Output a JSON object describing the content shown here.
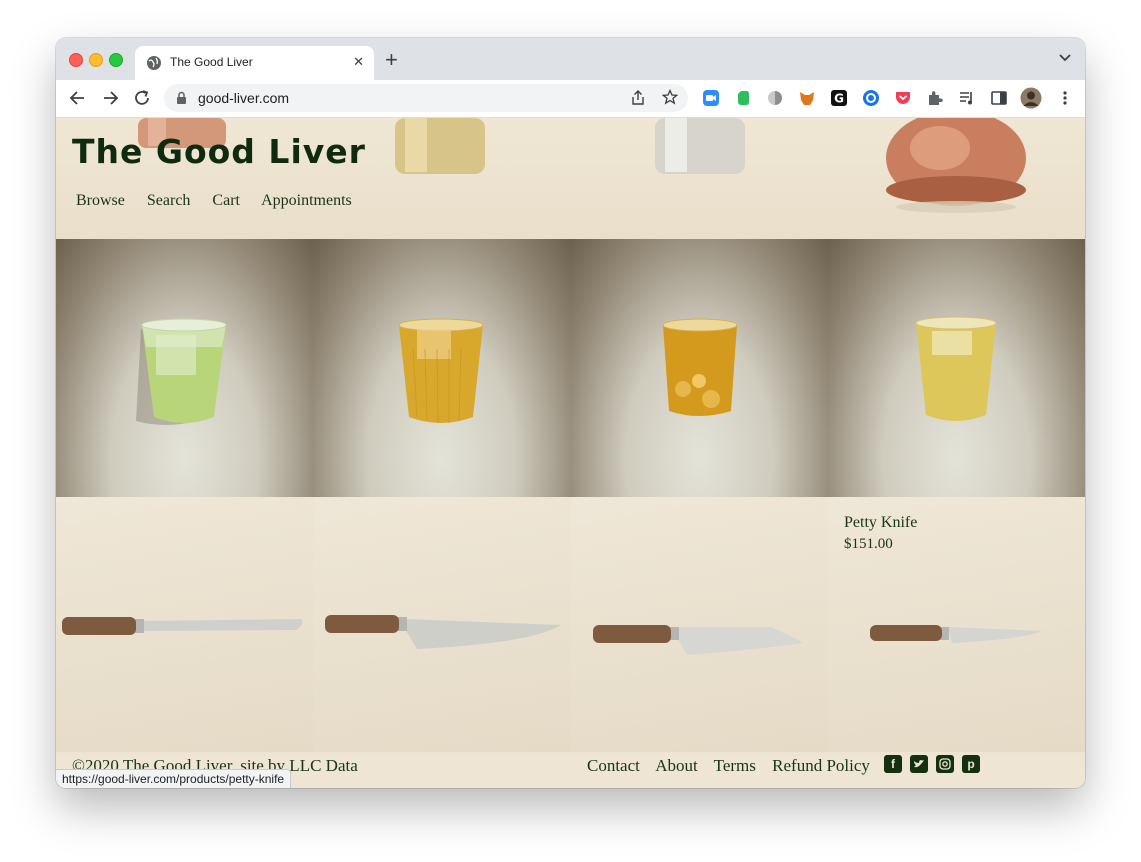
{
  "browser": {
    "tab_title": "The Good Liver",
    "url": "good-liver.com",
    "status_url": "https://good-liver.com/products/petty-knife"
  },
  "site": {
    "title": "The Good Liver",
    "nav": [
      "Browse",
      "Search",
      "Cart",
      "Appointments"
    ],
    "featured_product": {
      "name": "Petty Knife",
      "price": "$151.00"
    },
    "footer": {
      "copyright": "©2020 The Good Liver, site by LLC Data",
      "links": [
        "Contact",
        "About",
        "Terms",
        "Refund Policy"
      ],
      "social": [
        "facebook-icon",
        "twitter-icon",
        "instagram-icon",
        "pinterest-icon"
      ]
    }
  },
  "colors": {
    "brand_green": "#0f2a0e",
    "page_bg": "#ede4d2"
  }
}
